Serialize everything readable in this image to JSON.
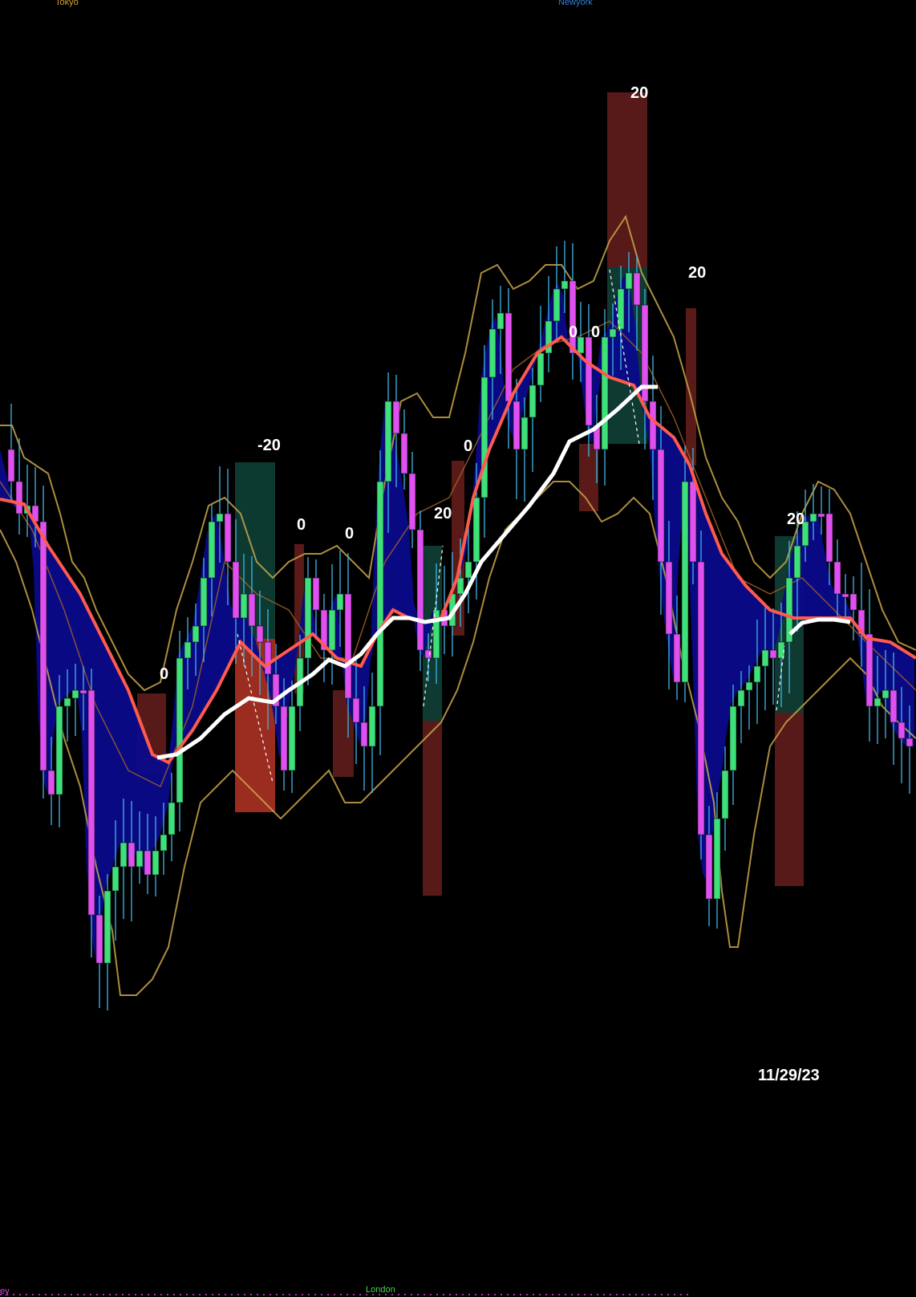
{
  "sessions": [
    {
      "label": "Tokyo",
      "color": "#d4a72c"
    },
    {
      "label": "Newyork",
      "color": "#2f7fd8"
    },
    {
      "label": "ey",
      "color": "#e040e0"
    },
    {
      "label": "London",
      "color": "#4cd14c"
    }
  ],
  "date_label": "11/29/23",
  "trade_labels": [
    "20",
    "20",
    "-20",
    "0",
    "0",
    "20",
    "0",
    "0",
    "20",
    "0",
    "0"
  ],
  "colors": {
    "background": "#000000",
    "bull_candle": "#3ee07a",
    "bear_candle": "#e050f0",
    "bull_small": "#2fd07a",
    "wick": "#3fb6e8",
    "ema_fast": "#ff5a4e",
    "ema_slow": "#ffffff",
    "cloud": "#0a0a8a",
    "bands": "#c9a64a",
    "box_profit": "#0e3a32",
    "box_loss": "#5a1a18",
    "box_loss_bright": "#9c2a1e"
  },
  "chart_data": {
    "type": "candlestick",
    "title": "",
    "xlabel": "",
    "ylabel": "",
    "price_axis": "none",
    "grid": false,
    "series": [
      {
        "name": "candles",
        "values": "approximate OHLC path (unlabeled)"
      }
    ],
    "annotations": [
      "20",
      "20",
      "-20",
      "0",
      "0",
      "20",
      "0",
      "0",
      "20",
      "0",
      "0",
      "11/29/23"
    ]
  }
}
